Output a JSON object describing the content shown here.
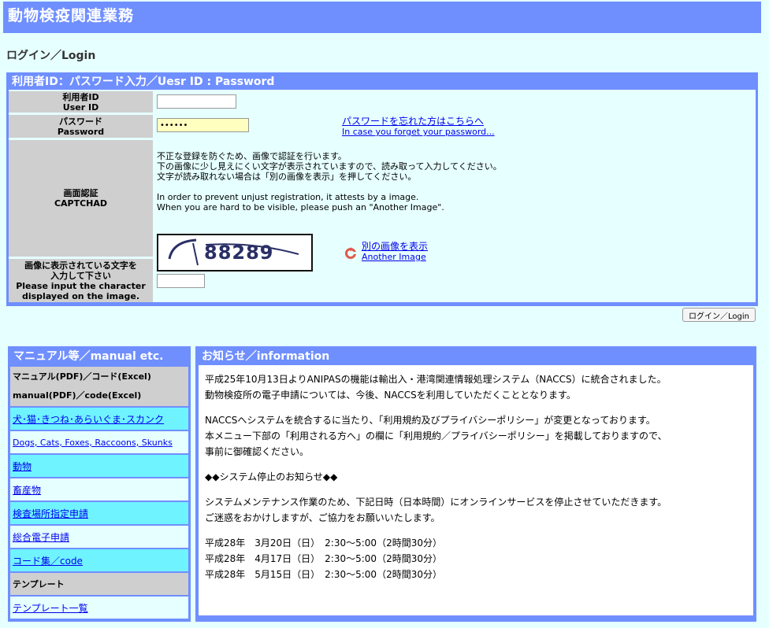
{
  "header": {
    "title": "動物検疫関連業務"
  },
  "page": {
    "title": "ログイン／Login"
  },
  "login": {
    "panel_title": "利用者ID：パスワード入力／Uesr ID : Password",
    "userid_label_ja": "利用者ID",
    "userid_label_en": "User ID",
    "userid_value": "",
    "password_label_ja": "パスワード",
    "password_label_en": "Password",
    "password_value": "••••••",
    "forgot_ja": "パスワードを忘れた方はこちらへ",
    "forgot_en": "In case you forget your password...",
    "captcha_label_ja": "画面認証",
    "captcha_label_en": "CAPTCHAD",
    "captcha_line1": "不正な登録を防ぐため、画像で認証を行います。",
    "captcha_line2": "下の画像に少し見えにくい文字が表示されていますので、読み取って入力してください。",
    "captcha_line3": "文字が読み取れない場合は「別の画像を表示」を押してください。",
    "captcha_en1": "In order to prevent unjust registration, it attests by a image.",
    "captcha_en2": "When you are hard to be visible, please push an \"Another Image\".",
    "captcha_text": "88289",
    "another_ja": "別の画像を表示",
    "another_en": "Another Image",
    "input_label_ja1": "画像に表示されている文字を",
    "input_label_ja2": "入力して下さい",
    "input_label_en1": "Please input the character",
    "input_label_en2": "displayed on the image.",
    "captcha_input_value": "",
    "button_label": "ログイン／Login"
  },
  "manual": {
    "title": "マニュアル等／manual etc.",
    "header_ja": "マニュアル(PDF)／コード(Excel)",
    "header_en": "manual(PDF)／code(Excel)",
    "items": [
      "犬･猫･きつね･あらいぐま･スカンク",
      "Dogs, Cats, Foxes, Raccoons, Skunks",
      "動物",
      "畜産物",
      "検査場所指定申請",
      "総合電子申請",
      "コード集／code"
    ],
    "template_header": "テンプレート",
    "template_link": "テンプレート一覧"
  },
  "info": {
    "title": "お知らせ／information",
    "p1_line1": "平成25年10月13日よりANIPASの機能は輸出入・港湾関連情報処理システム（NACCS）に統合されました。",
    "p1_line2": "動物検疫所の電子申請については、今後、NACCSを利用していただくこととなります。",
    "p2_line1": "NACCSへシステムを統合するに当たり、「利用規約及びプライバシーポリシー」が変更となっております。",
    "p2_line2": "本メニュー下部の「利用される方へ」の欄に「利用規約／プライバシーポリシー」を掲載しておりますので、",
    "p2_line3": "事前に御確認ください。",
    "notice_title": "◆◆システム停止のお知らせ◆◆",
    "p3_line1": "システムメンテナンス作業のため、下記日時（日本時間）にオンラインサービスを停止させていただきます。",
    "p3_line2": "ご迷惑をおかけしますが、ご協力をお願いいたします。",
    "dates": [
      "平成28年　3月20日（日）　2:30～5:00（2時間30分）",
      "平成28年　4月17日（日）　2:30～5:00（2時間30分）",
      "平成28年　5月15日（日）　2:30～5:00（2時間30分）"
    ]
  },
  "colors": {
    "header_blue": "#6f8fff",
    "page_bg": "#e6ffff",
    "label_grey": "#cfcfcf",
    "menu_cyan": "#6ff3ff",
    "link": "#0000ee",
    "password_bg": "#ffffc0"
  }
}
